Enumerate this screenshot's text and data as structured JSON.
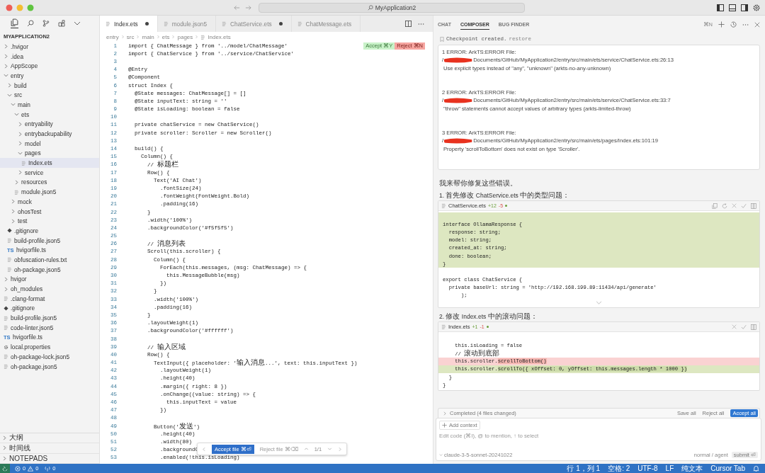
{
  "window": {
    "search": "MyApplication2"
  },
  "explorer": {
    "title": "MYAPPLICATION2",
    "tree": [
      {
        "label": ".hvigor",
        "kind": "folder",
        "expanded": false,
        "selected": false
      },
      {
        "label": ".idea",
        "kind": "folder",
        "expanded": false,
        "selected": false
      },
      {
        "label": "AppScope",
        "kind": "folder",
        "expanded": false,
        "selected": false
      },
      {
        "label": "entry",
        "kind": "folder",
        "expanded": true,
        "selected": false,
        "children": [
          {
            "label": "build",
            "kind": "folder",
            "expanded": false,
            "selected": false
          },
          {
            "label": "src",
            "kind": "folder",
            "expanded": true,
            "selected": false,
            "children": [
              {
                "label": "main",
                "kind": "folder",
                "expanded": true,
                "selected": false,
                "children": [
                  {
                    "label": "ets",
                    "kind": "folder",
                    "expanded": true,
                    "selected": false,
                    "children": [
                      {
                        "label": "entryability",
                        "kind": "folder",
                        "expanded": false,
                        "selected": false
                      },
                      {
                        "label": "entrybackupability",
                        "kind": "folder",
                        "expanded": false,
                        "selected": false
                      },
                      {
                        "label": "model",
                        "kind": "folder",
                        "expanded": false,
                        "selected": false
                      },
                      {
                        "label": "pages",
                        "kind": "folder",
                        "expanded": true,
                        "selected": false,
                        "children": [
                          {
                            "label": "Index.ets",
                            "kind": "file",
                            "selected": true
                          }
                        ]
                      },
                      {
                        "label": "service",
                        "kind": "folder",
                        "expanded": false,
                        "selected": false
                      }
                    ]
                  },
                  {
                    "label": "resources",
                    "kind": "folder",
                    "expanded": false,
                    "selected": false
                  },
                  {
                    "label": "module.json5",
                    "kind": "file",
                    "selected": false
                  }
                ]
              },
              {
                "label": "mock",
                "kind": "folder",
                "expanded": false,
                "selected": false
              },
              {
                "label": "ohosTest",
                "kind": "folder",
                "expanded": false,
                "selected": false
              },
              {
                "label": "test",
                "kind": "folder",
                "expanded": false,
                "selected": false
              }
            ]
          },
          {
            "label": ".gitignore",
            "kind": "git",
            "selected": false
          },
          {
            "label": "build-profile.json5",
            "kind": "file",
            "selected": false
          },
          {
            "label": "hvigorfile.ts",
            "kind": "ts",
            "badge": "TS",
            "selected": false
          },
          {
            "label": "obfuscation-rules.txt",
            "kind": "file",
            "selected": false
          },
          {
            "label": "oh-package.json5",
            "kind": "file",
            "selected": false
          }
        ]
      },
      {
        "label": "hvigor",
        "kind": "folder",
        "expanded": false,
        "selected": false
      },
      {
        "label": "oh_modules",
        "kind": "folder",
        "expanded": false,
        "selected": false
      },
      {
        "label": ".clang-format",
        "kind": "file",
        "selected": false
      },
      {
        "label": ".gitignore",
        "kind": "git",
        "selected": false
      },
      {
        "label": "build-profile.json5",
        "kind": "file",
        "selected": false
      },
      {
        "label": "code-linter.json5",
        "kind": "file",
        "selected": false
      },
      {
        "label": "hvigorfile.ts",
        "kind": "ts",
        "badge": "TS",
        "selected": false
      },
      {
        "label": "local.properties",
        "kind": "config",
        "selected": false
      },
      {
        "label": "oh-package-lock.json5",
        "kind": "file",
        "selected": false
      },
      {
        "label": "oh-package.json5",
        "kind": "file",
        "selected": false
      }
    ],
    "panels": [
      {
        "label": "大纲"
      },
      {
        "label": "时间线"
      },
      {
        "label": "NOTEPADS"
      }
    ]
  },
  "editor": {
    "tabs": [
      {
        "label": "Index.ets",
        "modified": true,
        "selected": true
      },
      {
        "label": "module.json5",
        "modified": false,
        "selected": false
      },
      {
        "label": "ChatService.ets",
        "modified": true,
        "selected": false
      },
      {
        "label": "ChatMessage.ets",
        "modified": false,
        "selected": false
      }
    ],
    "breadcrumb": [
      "entry",
      "src",
      "main",
      "ets",
      "pages",
      "Index.ets"
    ],
    "lines": [
      {
        "n": "1",
        "code": "import { ChatMessage } from '../model/ChatMessage'",
        "actions": [
          {
            "label": "Accept ⌘Y",
            "kind": "accept"
          },
          {
            "label": "Reject ⌘N",
            "kind": "reject"
          }
        ]
      },
      {
        "n": "2",
        "code": "import { ChatService } from '../service/ChatService'"
      },
      {
        "n": "3"
      },
      {
        "n": "4",
        "code": "@Entry"
      },
      {
        "n": "5",
        "code": "@Component"
      },
      {
        "n": "6",
        "code": "struct Index {"
      },
      {
        "n": "7",
        "code": "  @State messages: ChatMessage[] = []"
      },
      {
        "n": "8",
        "code": "  @State inputText: string = ''"
      },
      {
        "n": "9",
        "code": "  @State isLoading: boolean = false"
      },
      {
        "n": "10"
      },
      {
        "n": "11",
        "code": "  private chatService = new ChatService()"
      },
      {
        "n": "12",
        "code": "  private scroller: Scroller = new Scroller()"
      },
      {
        "n": "13"
      },
      {
        "n": "14",
        "code": "  build() {"
      },
      {
        "n": "15",
        "code": "    Column() {"
      },
      {
        "n": "16",
        "code": "      // 标题栏"
      },
      {
        "n": "17",
        "code": "      Row() {"
      },
      {
        "n": "18",
        "code": "        Text('AI Chat')"
      },
      {
        "n": "19",
        "code": "          .fontSize(24)"
      },
      {
        "n": "20",
        "code": "          .fontWeight(FontWeight.Bold)"
      },
      {
        "n": "21",
        "code": "          .padding(16)"
      },
      {
        "n": "22",
        "code": "      }"
      },
      {
        "n": "23",
        "code": "      .width('100%')"
      },
      {
        "n": "24",
        "code": "      .backgroundColor('#f5f5f5')"
      },
      {
        "n": "25"
      },
      {
        "n": "26",
        "code": "      // 消息列表"
      },
      {
        "n": "27",
        "code": "      Scroll(this.scroller) {"
      },
      {
        "n": "28",
        "code": "        Column() {"
      },
      {
        "n": "29",
        "code": "          ForEach(this.messages, (msg: ChatMessage) => {"
      },
      {
        "n": "30",
        "code": "            this.MessageBubble(msg)"
      },
      {
        "n": "31",
        "code": "          })"
      },
      {
        "n": "32",
        "code": "        }"
      },
      {
        "n": "33",
        "code": "        .width('100%')"
      },
      {
        "n": "34",
        "code": "        .padding(16)"
      },
      {
        "n": "35",
        "code": "      }"
      },
      {
        "n": "36",
        "code": "      .layoutWeight(1)"
      },
      {
        "n": "37",
        "code": "      .backgroundColor('#ffffff')"
      },
      {
        "n": "38"
      },
      {
        "n": "39",
        "code": "      // 输入区域"
      },
      {
        "n": "40",
        "code": "      Row() {"
      },
      {
        "n": "41",
        "code": "        TextInput({ placeholder: '输入消息...', text: this.inputText })"
      },
      {
        "n": "42",
        "code": "          .layoutWeight(1)"
      },
      {
        "n": "43",
        "code": "          .height(40)"
      },
      {
        "n": "44",
        "code": "          .margin({ right: 8 })"
      },
      {
        "n": "45",
        "code": "          .onChange((value: string) => {"
      },
      {
        "n": "46",
        "code": "            this.inputText = value"
      },
      {
        "n": "47",
        "code": "          })"
      },
      {
        "n": "48"
      },
      {
        "n": "49",
        "code": "        Button('发送')"
      },
      {
        "n": "50",
        "code": "          .height(40)"
      },
      {
        "n": "51",
        "code": "          .width(80)"
      },
      {
        "n": "52",
        "code": "          .backgroundC"
      },
      {
        "n": "53",
        "code": "          .enabled(!this.isLoading)"
      }
    ],
    "review": {
      "accept": "Accept file ⌘⏎",
      "reject": "Reject file ⌘⌫",
      "count": "1/1"
    }
  },
  "composer": {
    "tabs": [
      {
        "label": "CHAT",
        "selected": false
      },
      {
        "label": "COMPOSER",
        "selected": true
      },
      {
        "label": "BUG FINDER",
        "selected": false
      }
    ],
    "shortcut": "⌘N",
    "checkpoint": {
      "text": "Checkpoint created.",
      "link": "restore"
    },
    "errors": [
      {
        "heading": "1 ERROR: ArkTS:ERROR File:",
        "path_prefix": "/",
        "path": "Documents/GitHub/MyApplication2/entry/src/main/ets/service/ChatService.ets:26:13",
        "message": "Use explicit types instead of \"any\", \"unknown\" (arkts-no-any-unknown)"
      },
      {
        "heading": "2 ERROR: ArkTS:ERROR File:",
        "path_prefix": "/",
        "path": "Documents/GitHub/MyApplication2/entry/src/main/ets/service/ChatService.ets:33:7",
        "message": "\"throw\" statements cannot accept values of arbitrary types (arkts-limited-throw)"
      },
      {
        "heading": "3 ERROR: ArkTS:ERROR File:",
        "path_prefix": "/",
        "path": "Documents/GitHub/MyApplication2/entry/src/main/ets/pages/Index.ets:101:19",
        "message": "Property 'scrollToBottom' does not exist on type 'Scroller'."
      }
    ],
    "reply": "我来帮你修复这些错误。",
    "steps": [
      {
        "text": "1. 首先修改 ChatService.ets 中的类型问题：",
        "diff": {
          "file": "ChatService.ets",
          "added": "+12",
          "removed": "-5",
          "copy_actions": true,
          "expandable": true,
          "lines": [
            {
              "kind": "added"
            },
            {
              "kind": "added",
              "code": "interface OllamaResponse {"
            },
            {
              "kind": "added",
              "code": "  response: string;"
            },
            {
              "kind": "added",
              "code": "  model: string;"
            },
            {
              "kind": "added",
              "code": "  created_at: string;"
            },
            {
              "kind": "added",
              "code": "  done: boolean;"
            },
            {
              "kind": "added",
              "code": "}"
            },
            {
              "kind": "context"
            },
            {
              "kind": "context",
              "code": "export class ChatService {"
            },
            {
              "kind": "context",
              "code": "  private baseUrl: string = 'http://192.168.199.89:11434/api/generate'"
            },
            {
              "kind": "context",
              "code": "      );"
            }
          ]
        }
      },
      {
        "text": "2. 修改 Index.ets 中的滚动问题：",
        "diff": {
          "file": "Index.ets",
          "added": "+1",
          "removed": "-1",
          "copy_actions": false,
          "expandable": false,
          "lines": [
            {
              "kind": "context"
            },
            {
              "kind": "context",
              "code": "    this.isLoading = false"
            },
            {
              "kind": "context",
              "code": "    // 滚动到底部"
            },
            {
              "kind": "removed",
              "code": "    this.scroller.",
              "changed": "scrollToBottom()"
            },
            {
              "kind": "added",
              "code": "    this.scroller.",
              "changed": "scrollTo({ xOffset: 0, yOffset: this.messages.length * 1000 })"
            },
            {
              "kind": "context",
              "code": "  }"
            },
            {
              "kind": "context",
              "code": "}"
            }
          ]
        }
      }
    ],
    "completed": {
      "text": "Completed (4 files changed)",
      "save": "Save all",
      "reject": "Reject all",
      "accept": "Accept all"
    },
    "input": {
      "chip": "Add context",
      "placeholder": "Edit code (⌘I), @ to mention, ↑ to select",
      "model": "claude-3-5-sonnet-20241022",
      "mode": "normal / agent",
      "submit": "submit ⏎"
    }
  },
  "status_bar": {
    "errors": "0",
    "warnings": "0",
    "ports": "0",
    "items": [
      "行 1，列 1",
      "空格: 2",
      "UTF-8",
      "LF",
      "纯文本",
      "Cursor Tab"
    ]
  }
}
